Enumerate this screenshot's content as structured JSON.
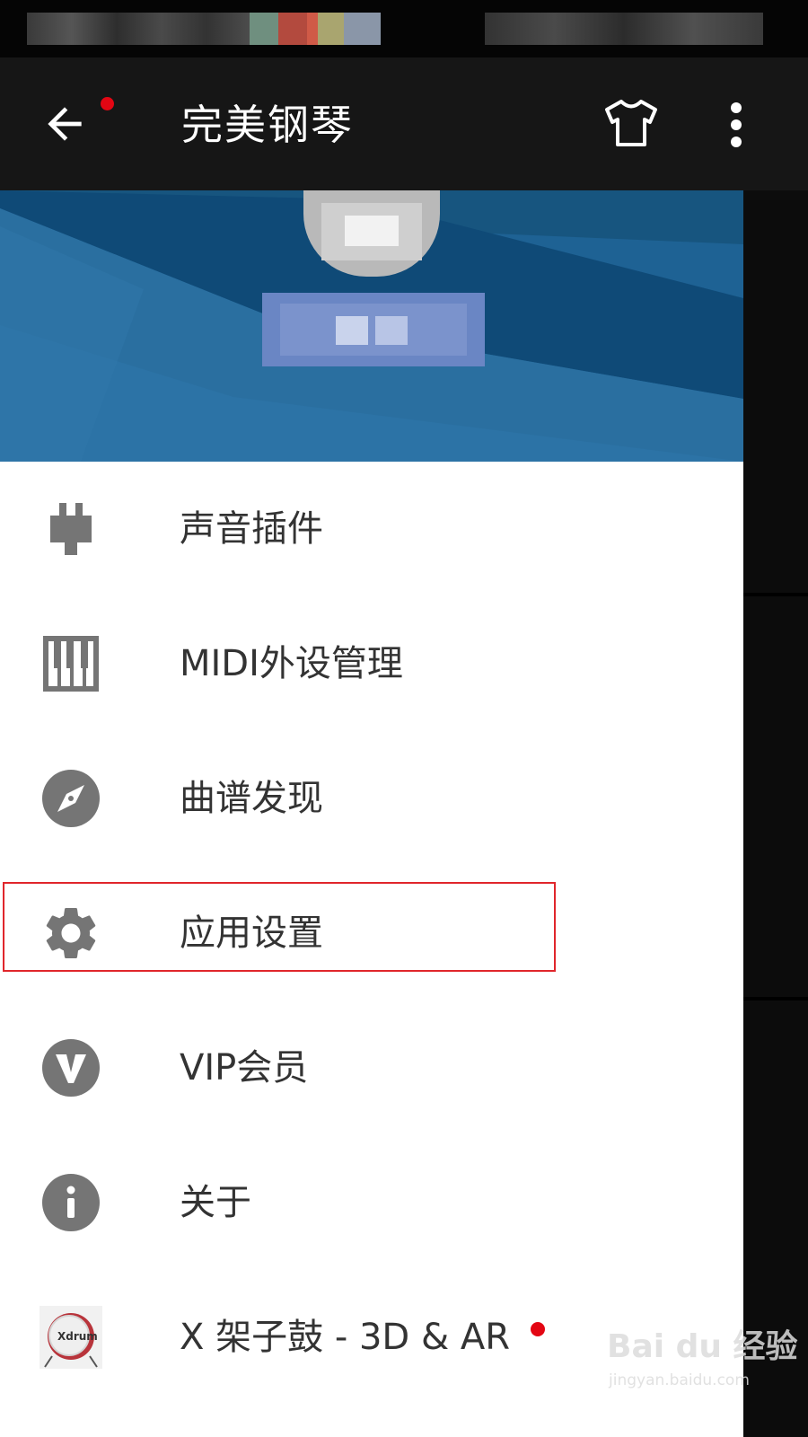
{
  "app_bar": {
    "title": "完美钢琴",
    "back_icon": "back-arrow-icon",
    "back_notification_color": "#e30613",
    "skin_icon": "tshirt-icon",
    "overflow_icon": "more-vert-icon",
    "background": "#161616"
  },
  "drawer": {
    "header_background": "#1f6596",
    "menu": [
      {
        "label": "声音插件",
        "icon": "plugin-icon"
      },
      {
        "label": "MIDI外设管理",
        "icon": "midi-keyboard-icon"
      },
      {
        "label": "曲谱发现",
        "icon": "compass-icon"
      },
      {
        "label": "应用设置",
        "icon": "gear-icon",
        "highlighted": true
      },
      {
        "label": "VIP会员",
        "icon": "vip-icon"
      },
      {
        "label": "关于",
        "icon": "info-icon"
      },
      {
        "label": "X 架子鼓 - 3D & AR",
        "icon": "drum-app-icon",
        "has_notification_dot": true
      }
    ],
    "highlight_color": "#e0262b",
    "icon_color": "#757575",
    "text_color": "#333333"
  },
  "watermark": {
    "main": "Bai du 经验",
    "sub": "jingyan.baidu.com"
  }
}
